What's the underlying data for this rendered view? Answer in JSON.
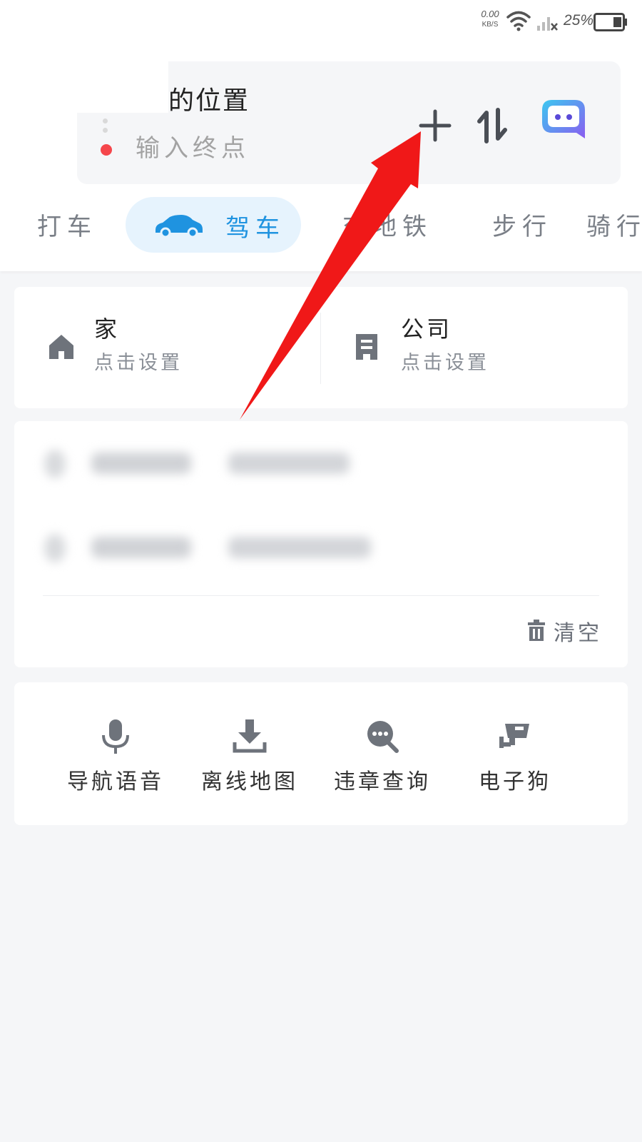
{
  "status_bar": {
    "net_speed": "0.00",
    "net_unit": "KB/S",
    "battery": "25%"
  },
  "route": {
    "start_text": "的位置",
    "end_placeholder": "输入终点"
  },
  "icons": {
    "add": "plus-icon",
    "swap": "swap-icon",
    "assistant": "assistant-bubble-icon"
  },
  "mode_tabs": [
    {
      "label": "打车"
    },
    {
      "label": "驾车",
      "active": true
    },
    {
      "label": "交地铁"
    },
    {
      "label": "步行"
    },
    {
      "label": "骑行"
    }
  ],
  "places": {
    "home": {
      "title": "家",
      "subtitle": "点击设置"
    },
    "company": {
      "title": "公司",
      "subtitle": "点击设置"
    }
  },
  "history": {
    "clear_label": "清空"
  },
  "tools": [
    {
      "label": "导航语音",
      "icon": "microphone-icon"
    },
    {
      "label": "离线地图",
      "icon": "download-icon"
    },
    {
      "label": "违章查询",
      "icon": "search-chat-icon"
    },
    {
      "label": "电子狗",
      "icon": "camera-icon"
    }
  ],
  "colors": {
    "accent": "#1f93e0",
    "end_dot": "#f5464b",
    "arrow": "#f01818"
  }
}
